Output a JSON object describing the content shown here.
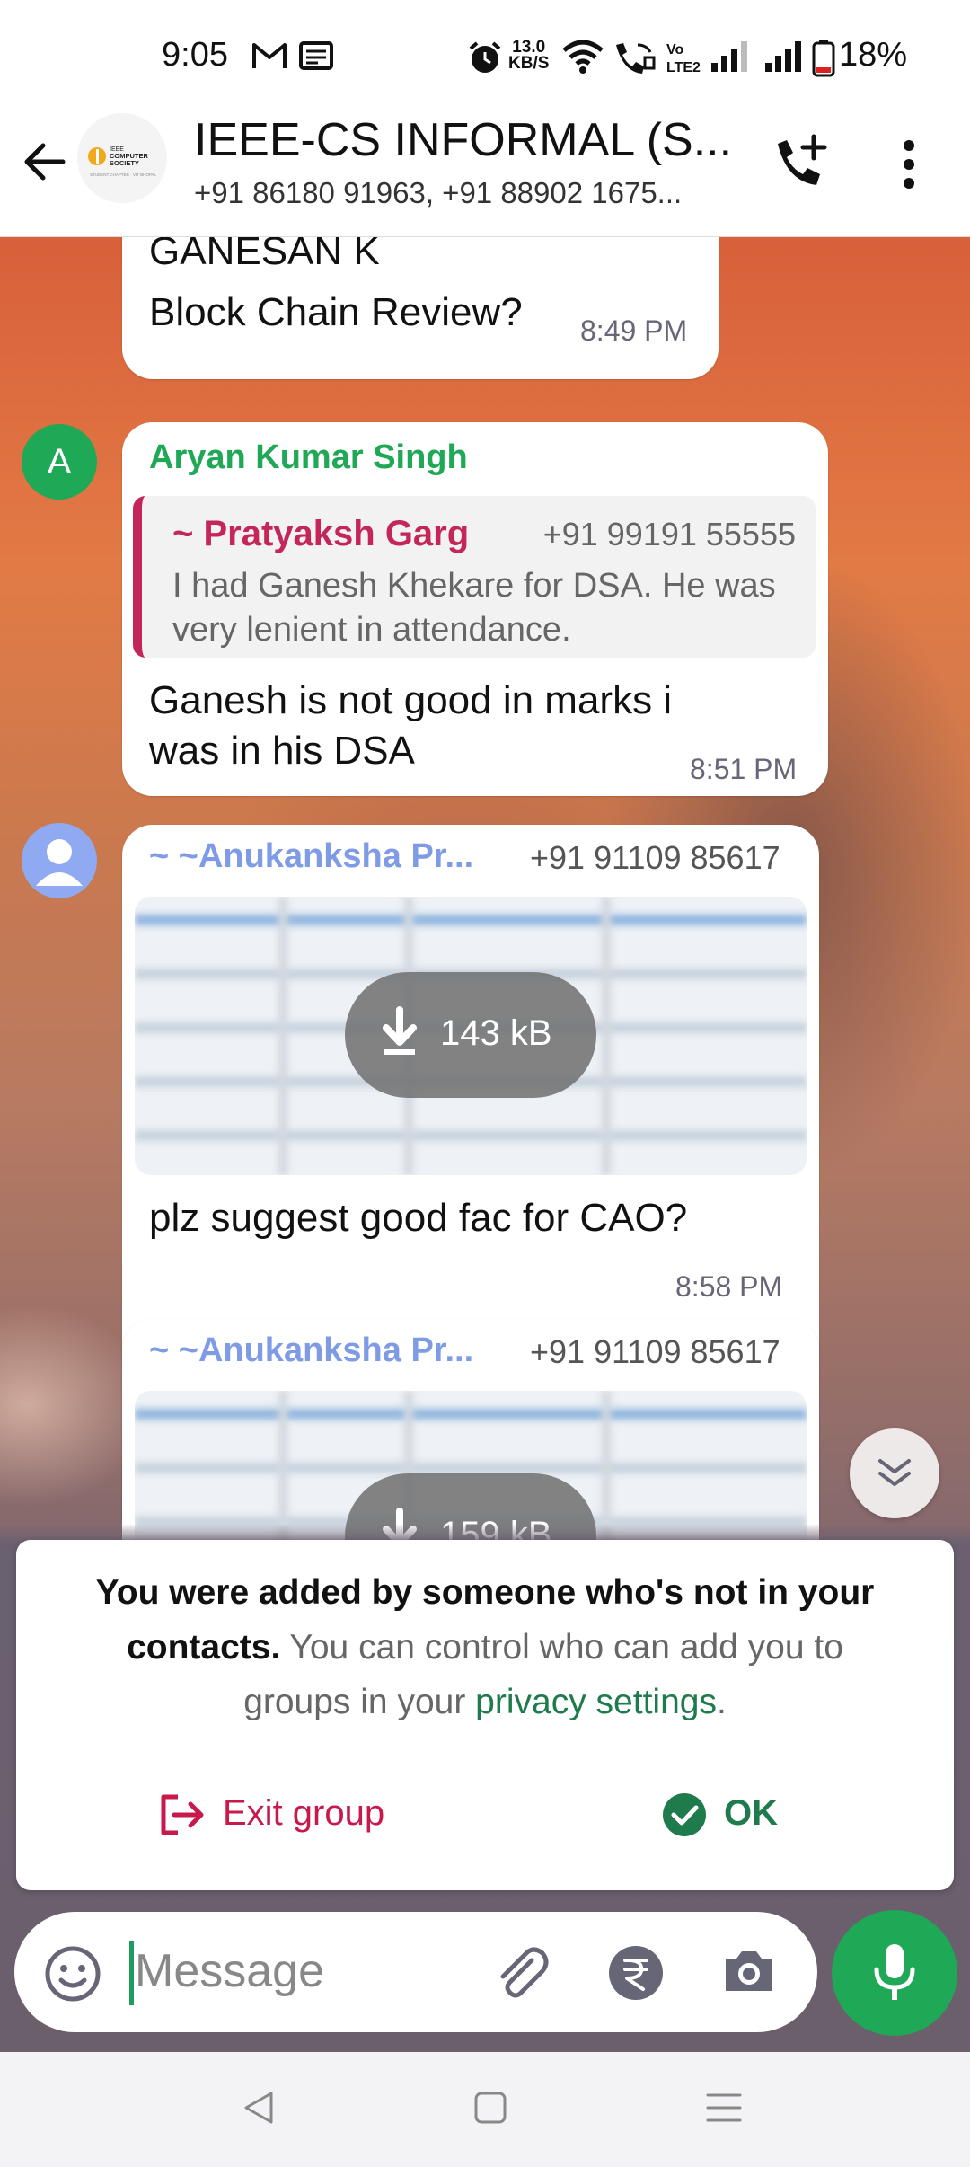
{
  "status_bar": {
    "time": "9:05",
    "net_speed": "13.0",
    "net_speed_unit": "KB/S",
    "battery_percent": "18%",
    "icons": [
      "gmail-icon",
      "news-icon",
      "alarm-icon",
      "wifi-icon",
      "wifi-calling-icon",
      "volte-icon",
      "signal-icon",
      "signal-icon",
      "battery-icon"
    ]
  },
  "header": {
    "title": "IEEE-CS INFORMAL (S...",
    "members": "+91 86180 91963, +91 88902 1675...",
    "avatar_label": "IEEE COMPUTER SOCIETY",
    "icons": [
      "back-arrow-icon",
      "add-call-icon",
      "more-options-icon"
    ]
  },
  "messages": [
    {
      "partial_sender": "GANESAN K",
      "text": "Block Chain Review?",
      "time": "8:49 PM"
    },
    {
      "avatar_letter": "A",
      "sender": "Aryan Kumar Singh",
      "quote": {
        "sender": "~ Pratyaksh Garg",
        "phone": "+91 99191 55555",
        "text": "I had Ganesh Khekare for DSA. He was very lenient in attendance."
      },
      "text_line1": "Ganesh is not good in marks i",
      "text_line2": "was in his DSA",
      "time": "8:51 PM"
    },
    {
      "sender": "~ ~Anukanksha Pr...",
      "phone": "+91 91109 85617",
      "attachment_size": "143 kB",
      "text": "plz suggest good fac for CAO?",
      "time": "8:58 PM"
    },
    {
      "sender": "~ ~Anukanksha Pr...",
      "phone": "+91 91109 85617",
      "attachment_size": "159 kB"
    }
  ],
  "banner": {
    "bold_text": "You were added by someone who's not in your contacts.",
    "text": "You can control who can add you to groups in your",
    "link": "privacy settings",
    "end": ".",
    "exit_label": "Exit group",
    "ok_label": "OK"
  },
  "composer": {
    "placeholder": "Message"
  },
  "colors": {
    "accent_green": "#1fa855",
    "link_green": "#1f7a4c",
    "quote_red": "#c4265a",
    "exit_red": "#c8194c",
    "sender_blue": "#7f9be6"
  }
}
